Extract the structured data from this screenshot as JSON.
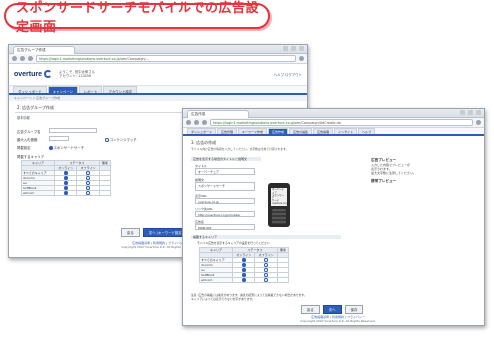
{
  "banner": {
    "title": "スポンサードサーチモバイルでの広告設定画面"
  },
  "w1": {
    "tab": "広告グループ作成",
    "url_host": "https://login1.marketingsolutions.overture.co.jp",
    "url_path": "/om/Campaign/...",
    "logo": "overture",
    "acct_lines": [
      "ようこそ, 田中太郎さん",
      "アカウント: 123456"
    ],
    "header_links": "ヘルプ  ログアウト",
    "tabs": [
      "ダッシュボード",
      "キャンペーン",
      "レポート",
      "アカウント設定"
    ],
    "sub": "キャンペーン > 広告グループ作成",
    "section": "2. 広告グループ作成",
    "basic": "基本情報",
    "fields": [
      "広告グループ名",
      "最大入札価格",
      "掲載設定"
    ],
    "opt_left": "スポンサードサーチ",
    "opt_right": "コンテンツマッチ",
    "dev_head": "掲載するキャリア",
    "grid_head": [
      "キャリア",
      "ステータス",
      "オンライン",
      "オフライン",
      "備考"
    ],
    "grid_rows": [
      "すべてのキャリア",
      "docomo",
      "au",
      "SoftBank",
      "willcom"
    ],
    "buttons": [
      "戻る",
      "次へ (キーワード設定)"
    ],
    "footer_links": "広告掲載基準 | 利用規約 | プライバシー",
    "copyright": "Copyright 2007 Overture K.K. All Rights Reserved."
  },
  "w2": {
    "tab": "広告作成",
    "url_host": "https://login1.marketingsolutions.overture.co.jp",
    "url_path": "/om/Campaign/AdCreate.do",
    "toplinks": [
      "ダッシュボード",
      "広告管理",
      "キーワード作成",
      "広告作成",
      "広告の編集",
      "広告掲載",
      "インサイト",
      "ヘルプ"
    ],
    "section": "3. 広告の作成",
    "intro": "モバイル向け広告の情報を入力してください。文字数は全角で計算されます。",
    "form_head": "広告を表示する場合のタイトルと説明文",
    "labels": [
      "タイトル",
      "説明文",
      "表示URL",
      "リンク先URL",
      "広告名"
    ],
    "values": [
      "オーバーチュア",
      "スポンサードサーチ",
      "overture.co.jp",
      "http://overture.co.jp/mobile/",
      "MOB-001"
    ],
    "preview_title": "広告プレビュー",
    "preview_text": [
      "入力した内容でプレビューが",
      "表示されます。",
      "最大文字数に注意してください。"
    ],
    "mobile_title": "携帯プレビュー",
    "phone_text": [
      "オーバーチュア",
      "スポンサード",
      "サーチ",
      "overture.co.jp"
    ],
    "carrier_head": "掲載するキャリア",
    "carrier_sub": "モバイル広告を表示するキャリアの設定を行ってください",
    "grid_head": [
      "キャリア",
      "ステータス",
      "オンライン",
      "オフライン",
      "備考"
    ],
    "grid_rows": [
      "すべてのキャリア",
      "docomo",
      "au",
      "SoftBank",
      "willcom"
    ],
    "notice": [
      "注意: 広告の掲載には審査があります。審査の結果によっては掲載できない場合があります。",
      "キャリアによっては表示できない文字があります。"
    ],
    "buttons": [
      "戻る",
      "次へ",
      "保存"
    ],
    "footer_links": "広告掲載基準 | 利用規約 | プライバシー",
    "copyright": "Copyright 2007 Overture K.K. All Rights Reserved."
  }
}
